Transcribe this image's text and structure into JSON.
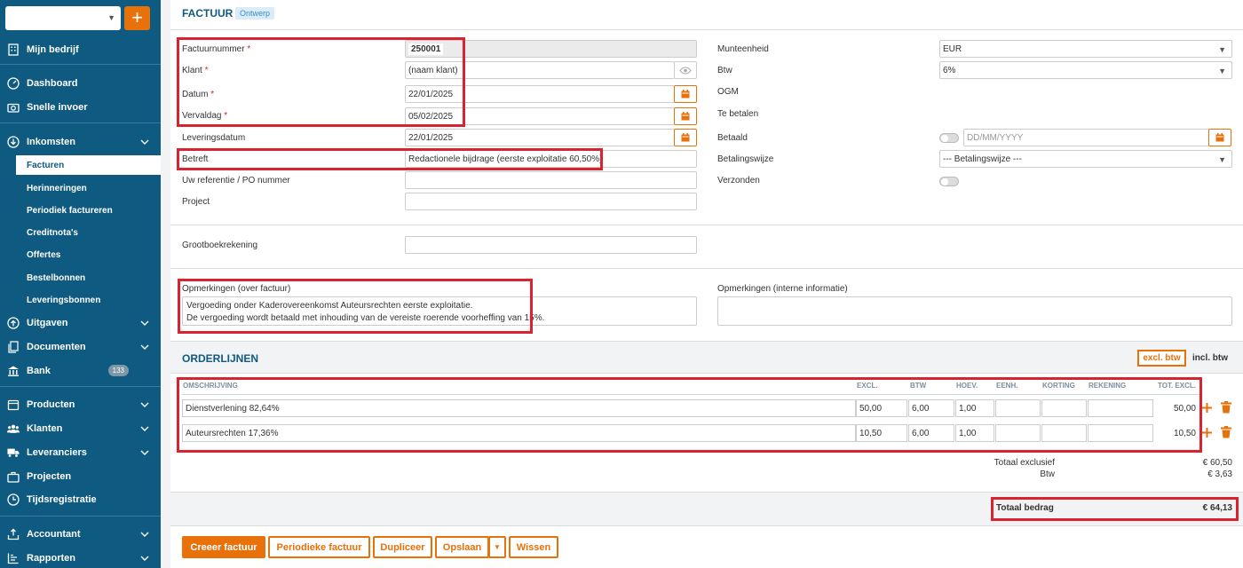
{
  "sidebar": {
    "items": [
      {
        "label": "Mijn bedrijf",
        "icon": "building-icon"
      },
      {
        "label": "Dashboard",
        "icon": "dashboard-icon"
      },
      {
        "label": "Snelle invoer",
        "icon": "camera-icon"
      },
      {
        "label": "Inkomsten",
        "icon": "download-circle-icon"
      },
      {
        "label": "Uitgaven",
        "icon": "upload-circle-icon"
      },
      {
        "label": "Documenten",
        "icon": "documents-icon"
      },
      {
        "label": "Bank",
        "icon": "bank-icon",
        "badge": "133"
      },
      {
        "label": "Producten",
        "icon": "box-icon"
      },
      {
        "label": "Klanten",
        "icon": "users-icon"
      },
      {
        "label": "Leveranciers",
        "icon": "truck-icon"
      },
      {
        "label": "Projecten",
        "icon": "briefcase-icon"
      },
      {
        "label": "Tijdsregistratie",
        "icon": "clock-icon"
      },
      {
        "label": "Accountant",
        "icon": "accountant-icon"
      },
      {
        "label": "Rapporten",
        "icon": "report-icon"
      }
    ],
    "subitems": [
      "Facturen",
      "Herinneringen",
      "Periodiek factureren",
      "Creditnota's",
      "Offertes",
      "Bestelbonnen",
      "Leveringsbonnen"
    ]
  },
  "header": {
    "title": "FACTUUR",
    "status": "Ontwerp"
  },
  "form": {
    "invoice_number_label": "Factuurnummer",
    "invoice_number": "250001",
    "client_label": "Klant",
    "client": "(naam klant)",
    "date_label": "Datum",
    "date": "22/01/2025",
    "due_label": "Vervaldag",
    "due": "05/02/2025",
    "delivery_label": "Leveringsdatum",
    "delivery": "22/01/2025",
    "subject_label": "Betreft",
    "subject": "Redactionele bijdrage (eerste exploitatie 60,50%)",
    "reference_label": "Uw referentie / PO nummer",
    "project_label": "Project",
    "ledger_label": "Grootboekrekening",
    "currency_label": "Munteenheid",
    "currency": "EUR",
    "vat_label": "Btw",
    "vat": "6%",
    "ogm_label": "OGM",
    "to_pay_label": "Te betalen",
    "paid_label": "Betaald",
    "paid_placeholder": "DD/MM/YYYY",
    "payment_label": "Betalingswijze",
    "payment": "--- Betalingswijze ---",
    "sent_label": "Verzonden",
    "remarks_label": "Opmerkingen (over factuur)",
    "remarks_line1": "Vergoeding onder Kaderovereenkomst Auteursrechten eerste exploitatie.",
    "remarks_line2": "De vergoeding wordt betaald met inhouding van de vereiste roerende voorheffing van 15%.",
    "internal_label": "Opmerkingen (interne informatie)"
  },
  "orderlines": {
    "title": "ORDERLIJNEN",
    "excl_btn": "excl. btw",
    "incl_btn": "incl. btw",
    "headers": [
      "OMSCHRIJVING",
      "EXCL.",
      "BTW",
      "HOEV.",
      "EENH.",
      "KORTING",
      "REKENING",
      "TOT. EXCL."
    ],
    "rows": [
      {
        "desc": "Dienstverlening 82,64%",
        "excl": "50,00",
        "btw": "6,00",
        "qty": "1,00",
        "total": "50,00"
      },
      {
        "desc": "Auteursrechten 17,36%",
        "excl": "10,50",
        "btw": "6,00",
        "qty": "1,00",
        "total": "10,50"
      }
    ]
  },
  "totals": {
    "excl_label": "Totaal exclusief",
    "excl": "€ 60,50",
    "vat_label": "Btw",
    "vat": "€ 3,63",
    "total_label": "Totaal bedrag",
    "total": "€ 64,13"
  },
  "actions": {
    "create": "Creeer factuur",
    "periodic": "Periodieke factuur",
    "duplicate": "Dupliceer",
    "save": "Opslaan",
    "clear": "Wissen"
  },
  "colors": {
    "sidebar": "#0e5a80",
    "accent": "#e8710a",
    "highlight": "#d9232e"
  }
}
